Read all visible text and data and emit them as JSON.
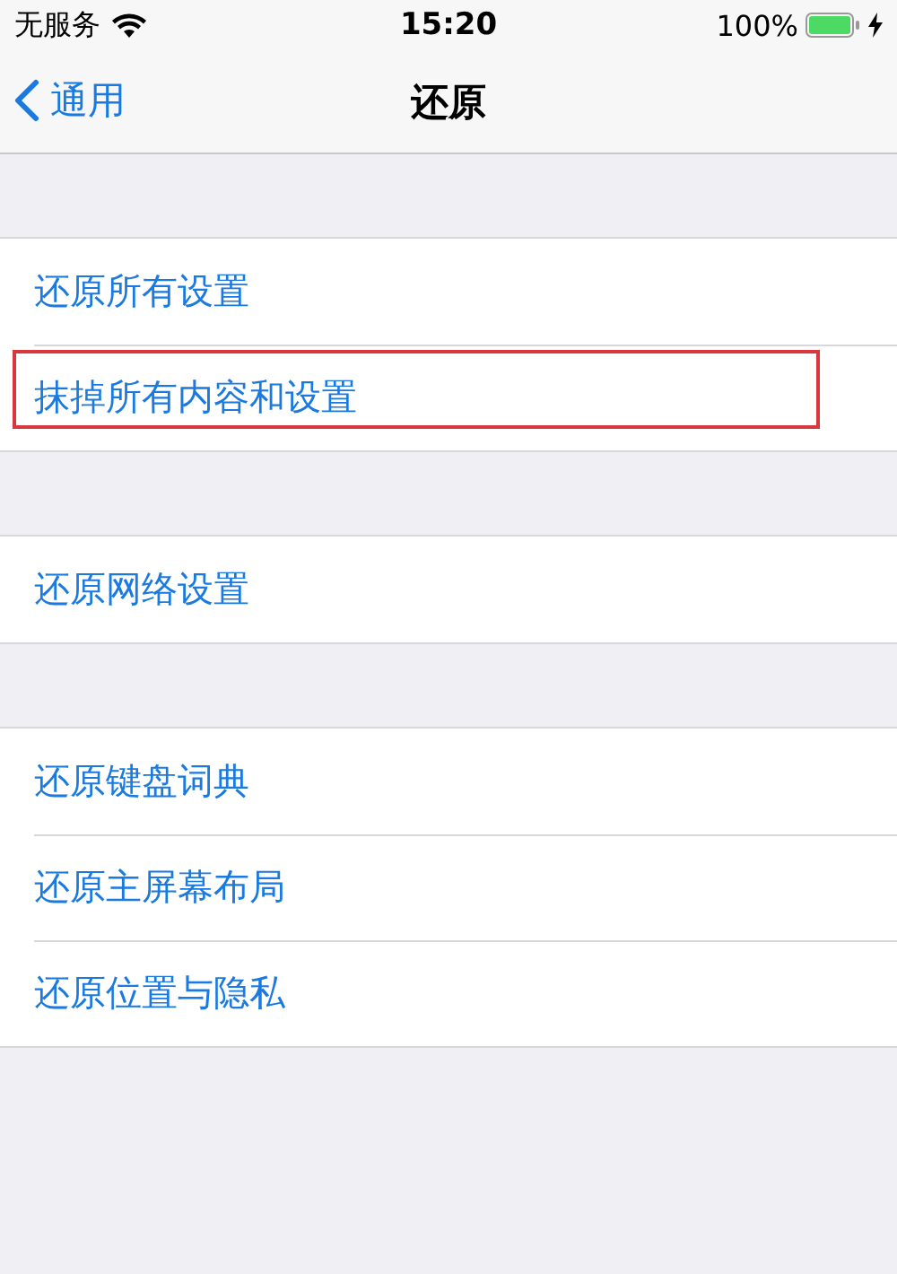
{
  "status_bar": {
    "carrier": "无服务",
    "time": "15:20",
    "battery": "100%",
    "charging": true
  },
  "nav_bar": {
    "back": "通用",
    "title": "还原"
  },
  "groups": [
    {
      "items": [
        {
          "label": "还原所有设置",
          "highlighted": false
        },
        {
          "label": "抹掉所有内容和设置",
          "highlighted": true
        }
      ]
    },
    {
      "items": [
        {
          "label": "还原网络设置",
          "highlighted": false
        }
      ]
    },
    {
      "items": [
        {
          "label": "还原键盘词典",
          "highlighted": false
        },
        {
          "label": "还原主屏幕布局",
          "highlighted": false
        },
        {
          "label": "还原位置与隐私",
          "highlighted": false
        }
      ]
    }
  ]
}
